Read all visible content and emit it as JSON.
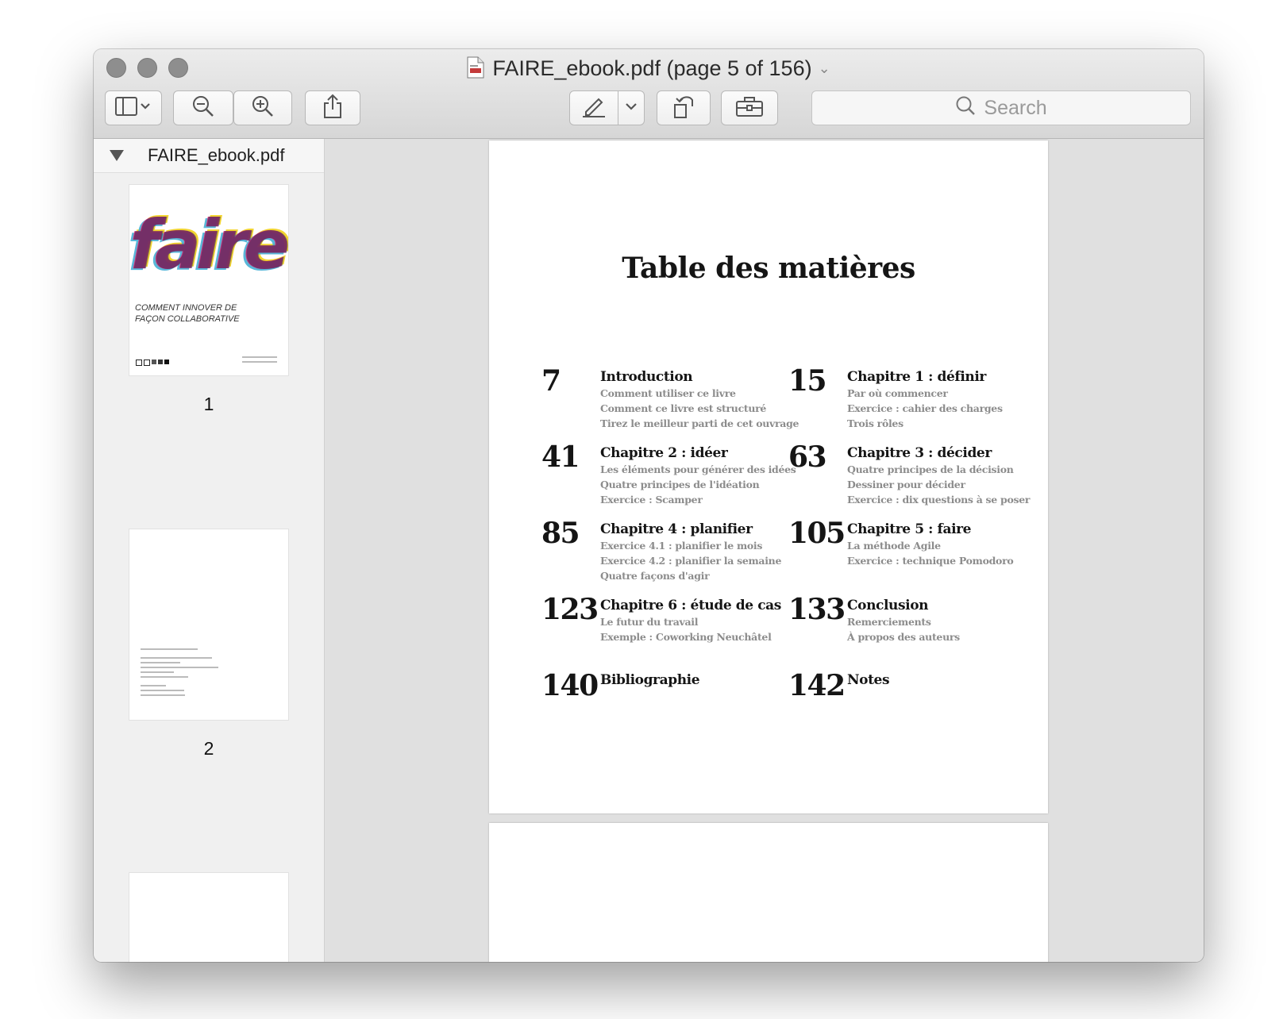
{
  "window": {
    "title": "FAIRE_ebook.pdf (page 5 of 156)"
  },
  "toolbar": {
    "sidebar_icon": "sidebar-icon",
    "zoom_out_icon": "zoom-out-icon",
    "zoom_in_icon": "zoom-in-icon",
    "share_icon": "share-icon",
    "markup_icon": "pen-icon",
    "rotate_icon": "rotate-icon",
    "toolbox_icon": "toolbox-icon",
    "search_placeholder": "Search"
  },
  "sidebar": {
    "file_name": "FAIRE_ebook.pdf",
    "thumbnails": [
      {
        "page_number": "1",
        "cover_word": "faire",
        "cover_subtitle_line1": "COMMENT INNOVER DE",
        "cover_subtitle_line2": "FAÇON COLLABORATIVE"
      },
      {
        "page_number": "2"
      }
    ]
  },
  "document": {
    "toc_title": "Table des matières",
    "entries": [
      {
        "page": "7",
        "heading": "Introduction",
        "subs": [
          "Comment utiliser ce livre",
          "Comment ce livre est structuré",
          "Tirez le meilleur parti de cet ouvrage"
        ]
      },
      {
        "page": "15",
        "heading": "Chapitre 1 : définir",
        "subs": [
          "Par où commencer",
          "Exercice : cahier des charges",
          "Trois rôles"
        ]
      },
      {
        "page": "41",
        "heading": "Chapitre 2 : idéer",
        "subs": [
          "Les éléments pour générer des idées",
          "Quatre principes de l'idéation",
          "Exercice : Scamper"
        ]
      },
      {
        "page": "63",
        "heading": "Chapitre 3 : décider",
        "subs": [
          "Quatre principes de la décision",
          "Dessiner pour décider",
          "Exercice : dix questions à se poser"
        ]
      },
      {
        "page": "85",
        "heading": "Chapitre 4 : planifier",
        "subs": [
          "Exercice 4.1 : planifier le mois",
          "Exercice 4.2 : planifier la semaine",
          "Quatre façons d'agir"
        ]
      },
      {
        "page": "105",
        "heading": "Chapitre 5 : faire",
        "subs": [
          "La méthode Agile",
          "Exercice : technique Pomodoro"
        ]
      },
      {
        "page": "123",
        "heading": "Chapitre 6 : étude de cas",
        "subs": [
          "Le futur du travail",
          "Exemple : Coworking Neuchâtel"
        ]
      },
      {
        "page": "133",
        "heading": "Conclusion",
        "subs": [
          "Remerciements",
          "À propos des auteurs"
        ]
      },
      {
        "page": "140",
        "heading": "Bibliographie",
        "subs": []
      },
      {
        "page": "142",
        "heading": "Notes",
        "subs": []
      }
    ]
  }
}
